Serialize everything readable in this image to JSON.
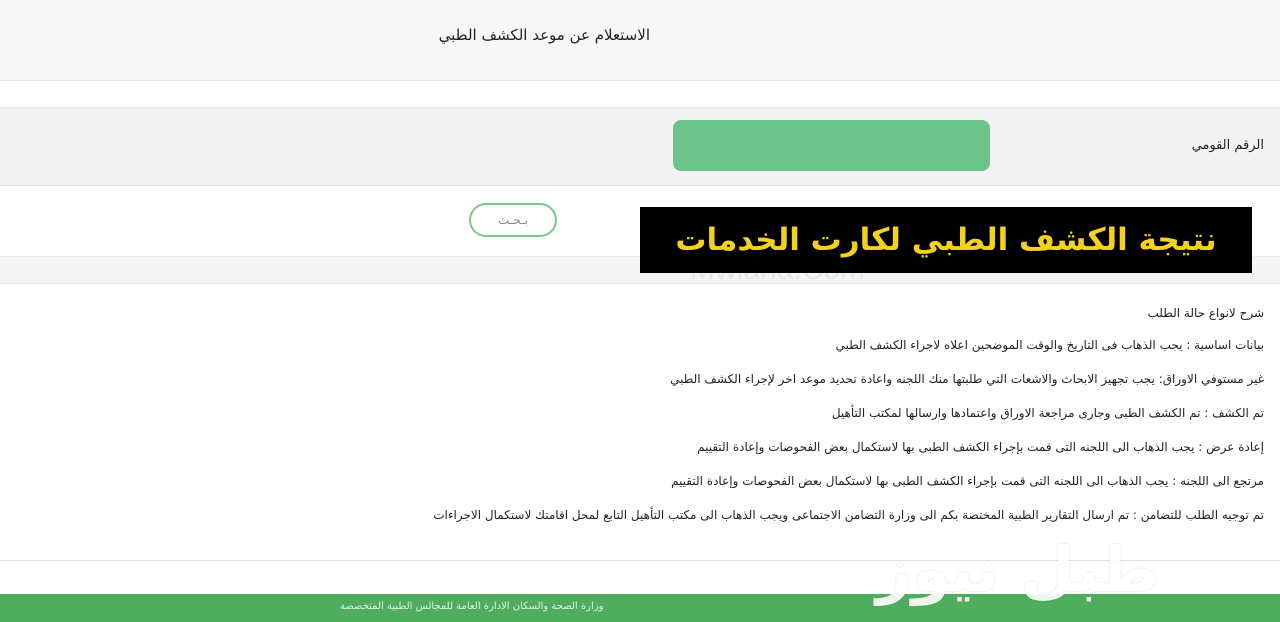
{
  "header": {
    "title": "الاستعلام عن موعد الكشف الطبي"
  },
  "form": {
    "id_label": "الرقم القومي",
    "id_value": "",
    "search_label": "بـحـث"
  },
  "banner": {
    "text": "نتيجة الكشف الطبي لكارت الخدمات",
    "color": "#f5d21a"
  },
  "watermarks": {
    "mid": "Mwlana.Com",
    "logo": "طبل نيوز"
  },
  "info": {
    "heading": "شرح لانواع حالة الطلب",
    "items": [
      "بيانات اساسية : يجب الذهاب فى التاريخ والوقت الموضحين اعلاه لاجراء الكشف الطبي",
      "غير مستوفي الاوراق: يجب تجهيز الابحاث والاشعات التي طلبتها منك اللجنه واعادة تحديد موعد اخر لإجراء الكشف الطبي",
      "تم الكشف : تم الكشف الطبى وجارى مراجعة الاوراق واعتمادها وارسالها لمكتب التأهيل",
      "إعادة عرض : يجب الذهاب الى اللجنه التى قمت بإجراء الكشف الطبى بها لاستكمال بعض الفحوصات وإعادة التقييم",
      "مرتجع الى اللجنه : يجب الذهاب الى اللجنه التى قمت بإجراء الكشف الطبى بها لاستكمال بعض الفحوصات وإعادة التقييم",
      "تم توجيه الطلب للتضامن : تم ارسال التقارير الطبية المختصة بكم الى وزارة التضامن الاجتماعى ويجب الذهاب الى مكتب التأهيل التابع لمحل اقامتك لاستكمال الاجراءات"
    ]
  },
  "footer": {
    "text": "وزارة الصحة والسكان الادارة العامة للمجالس الطبية المتخصصة"
  },
  "colors": {
    "accent_green": "#6dc48a",
    "footer_green": "#4fae5e"
  }
}
